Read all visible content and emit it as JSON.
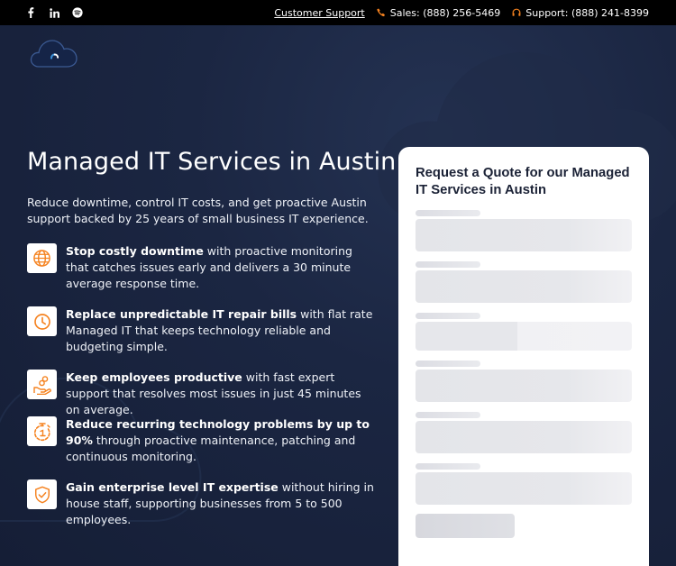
{
  "topbar": {
    "social": [
      "facebook-icon",
      "linkedin-icon",
      "spotify-icon"
    ],
    "customer_support": "Customer Support",
    "sales": "Sales: (888) 256-5469",
    "support": "Support: (888) 241-8399"
  },
  "hero": {
    "title": "Managed IT Services in Austin",
    "intro": "Reduce downtime, control IT costs, and get proactive Austin support backed by 25 years of small business IT experience."
  },
  "benefits": [
    {
      "icon": "globe-icon",
      "bold": "Stop costly downtime",
      "rest": " with proactive monitoring that catches issues early and delivers a 30 minute average response time."
    },
    {
      "icon": "clock-icon",
      "bold": "Replace unpredictable IT repair bills",
      "rest": " with flat rate Managed IT that keeps technology reliable and budgeting simple."
    },
    {
      "icon": "hand-coins-icon",
      "bold": "Keep employees productive",
      "rest": " with fast expert support that resolves most issues in just 45 minutes on average."
    },
    {
      "icon": "timer-icon",
      "bold": "Reduce recurring technology problems by up to 90%",
      "rest": " through proactive maintenance, patching and continuous monitoring."
    },
    {
      "icon": "shield-check-icon",
      "bold": "Gain enterprise level IT expertise",
      "rest": " without hiring in house staff, supporting businesses from 5 to 500 employees."
    }
  ],
  "quote_form": {
    "title": "Request a Quote for our Managed IT Services in Austin"
  },
  "colors": {
    "accent": "#f5821f",
    "background": "#17223b",
    "topbar": "#000000"
  }
}
